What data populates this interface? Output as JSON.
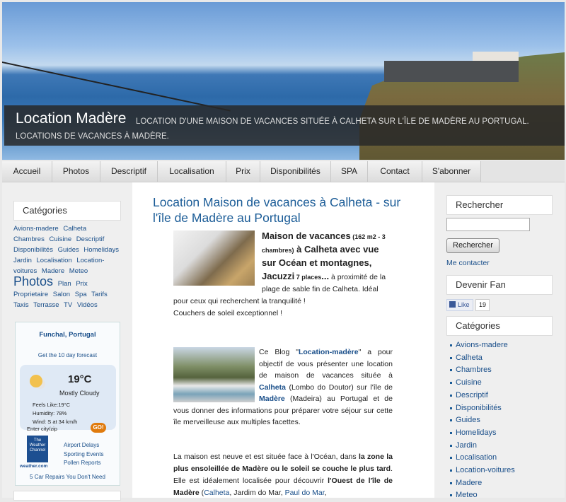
{
  "header": {
    "title": "Location Madère",
    "description": "Location d'une maison de vacances située à Calheta sur l'île de Madère au Portugal. Locations de vacances à Madère."
  },
  "nav": [
    "Accueil",
    "Photos",
    "Descriptif",
    "Localisation",
    "Prix",
    "Disponibilités",
    "SPA",
    "Contact",
    "S'abonner"
  ],
  "left": {
    "categories_title": "Catégories",
    "tags": [
      "Avions-madere",
      "Calheta",
      "Chambres",
      "Cuisine",
      "Descriptif",
      "Disponibilités",
      "Guides",
      "Homelidays",
      "Jardin",
      "Localisation",
      "Location-voitures",
      "Madere",
      "Meteo",
      "Photos",
      "Plan",
      "Prix",
      "Proprietaire",
      "Salon",
      "Spa",
      "Tarifs",
      "Taxis",
      "Terrasse",
      "TV",
      "Vidéos"
    ],
    "weather": {
      "location": "Funchal, Portugal",
      "forecast_link": "Get the 10 day forecast",
      "temperature": "19°C",
      "condition": "Mostly Cloudy",
      "feels_like": "Feels Like:19°C",
      "humidity": "Humidity: 78%",
      "wind": "Wind: S at 34 km/h",
      "entry_label": "Enter city/zip",
      "go": "GO!",
      "twc_brand": "The Weather Channel",
      "twc_url": "weather.com",
      "links": [
        "Airport Delays",
        "Sporting Events",
        "Pollen Reports"
      ],
      "ad": "5 Car Repairs You Don't Need"
    }
  },
  "main": {
    "title": "Location Maison de vacances à Calheta - sur l'île de Madère au Portugal",
    "p1": {
      "b1": "Maison de vacances",
      "s1": " (162 m2 - 3 chambres)",
      "b2": " à Calheta avec vue sur Océan et montagnes, Jacuzzi",
      "s2": " 7 places",
      "b3": "...",
      "t1": " à proximité de la plage de sable fin de Calheta. Idéal pour ceux qui recherchent la tranquilité !",
      "t2": "Couchers de soleil exceptionnel !"
    },
    "p2": {
      "t1": "Ce Blog \"",
      "link1": "Location-madère",
      "t2": "\" a pour objectif de vous présenter une location de maison de vacances située à ",
      "link2": "Calheta",
      "t3": " (Lombo do Doutor) sur l'île de ",
      "link3": "Madère",
      "t4": " (Madeira) au Portugal et de vous donner des informations pour préparer votre séjour sur cette île merveilleuse aux multiples facettes."
    },
    "p3": {
      "t1": "La maison est neuve et est située face à l'Océan, dans ",
      "b1": "la zone la plus ensoleillée de Madère ou le soleil se couche le plus tard",
      "t2": ". Elle est idéalement localisée pour découvrir ",
      "b2": "l'Ouest de l'île de Madère",
      "t3": " (",
      "link1": "Calheta",
      "t4": ", Jardim do Mar, ",
      "link2": "Paul do Mar",
      "t5": ","
    }
  },
  "right": {
    "search_title": "Rechercher",
    "search_button": "Rechercher",
    "contact": "Me contacter",
    "fan_title": "Devenir Fan",
    "like": "Like",
    "like_count": "19",
    "categories_title": "Catégories",
    "categories": [
      "Avions-madere",
      "Calheta",
      "Chambres",
      "Cuisine",
      "Descriptif",
      "Disponibilités",
      "Guides",
      "Homelidays",
      "Jardin",
      "Localisation",
      "Location-voitures",
      "Madere",
      "Meteo"
    ]
  }
}
